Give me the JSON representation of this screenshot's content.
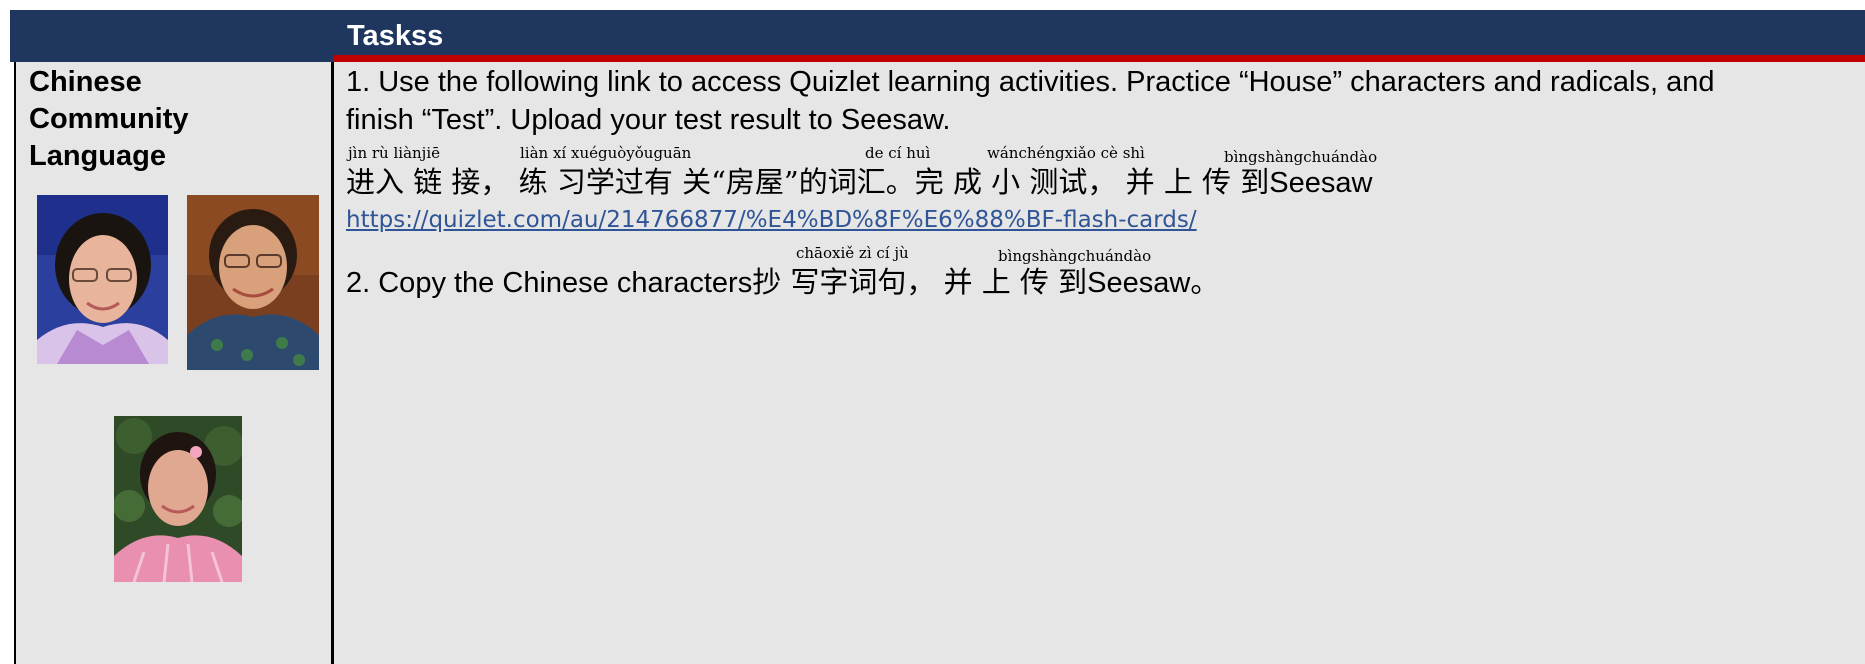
{
  "header": {
    "title": "Taskss",
    "bar_color": "#1f365f",
    "accent_color": "#c00000"
  },
  "left_column": {
    "label_line1": "Chinese",
    "label_line2": "Community",
    "label_line3": "Language",
    "photos": [
      "teacher-photo-1",
      "teacher-photo-2",
      "teacher-photo-3"
    ]
  },
  "task1": {
    "line1": "1. Use the following link to access Quizlet learning activities. Practice “House” characters and radicals, and",
    "line2": "finish “Test”. Upload your test result to Seesaw.",
    "pinyin": {
      "p1": "jìn rù liànjiē",
      "p2": "liàn xí xuéguòyǒuguān",
      "p3": "de cí huì",
      "p4": "wánchéngxiǎo cè shì",
      "p5": "bìngshàngchuándào"
    },
    "chinese": {
      "c1": "进入 链 接，",
      "c2": "练 习学过有 关“房屋”的词汇。",
      "c3": "完 成 小 测试，",
      "c4": "并 上 传 到",
      "c5": "Seesaw"
    },
    "link": "https://quizlet.com/au/214766877/%E4%BD%8F%E6%88%BF-flash-cards/",
    "link_color": "#2f5597"
  },
  "task2": {
    "text_prefix": "2. Copy the Chinese characters",
    "pinyin": {
      "p1": "chāoxiě zì  cí  jù",
      "p2": "bìngshàngchuándào"
    },
    "chinese": {
      "c1": "抄 写字词句，",
      "c2": "并 上 传 到",
      "c3": "Seesaw",
      "c4": "。"
    }
  }
}
